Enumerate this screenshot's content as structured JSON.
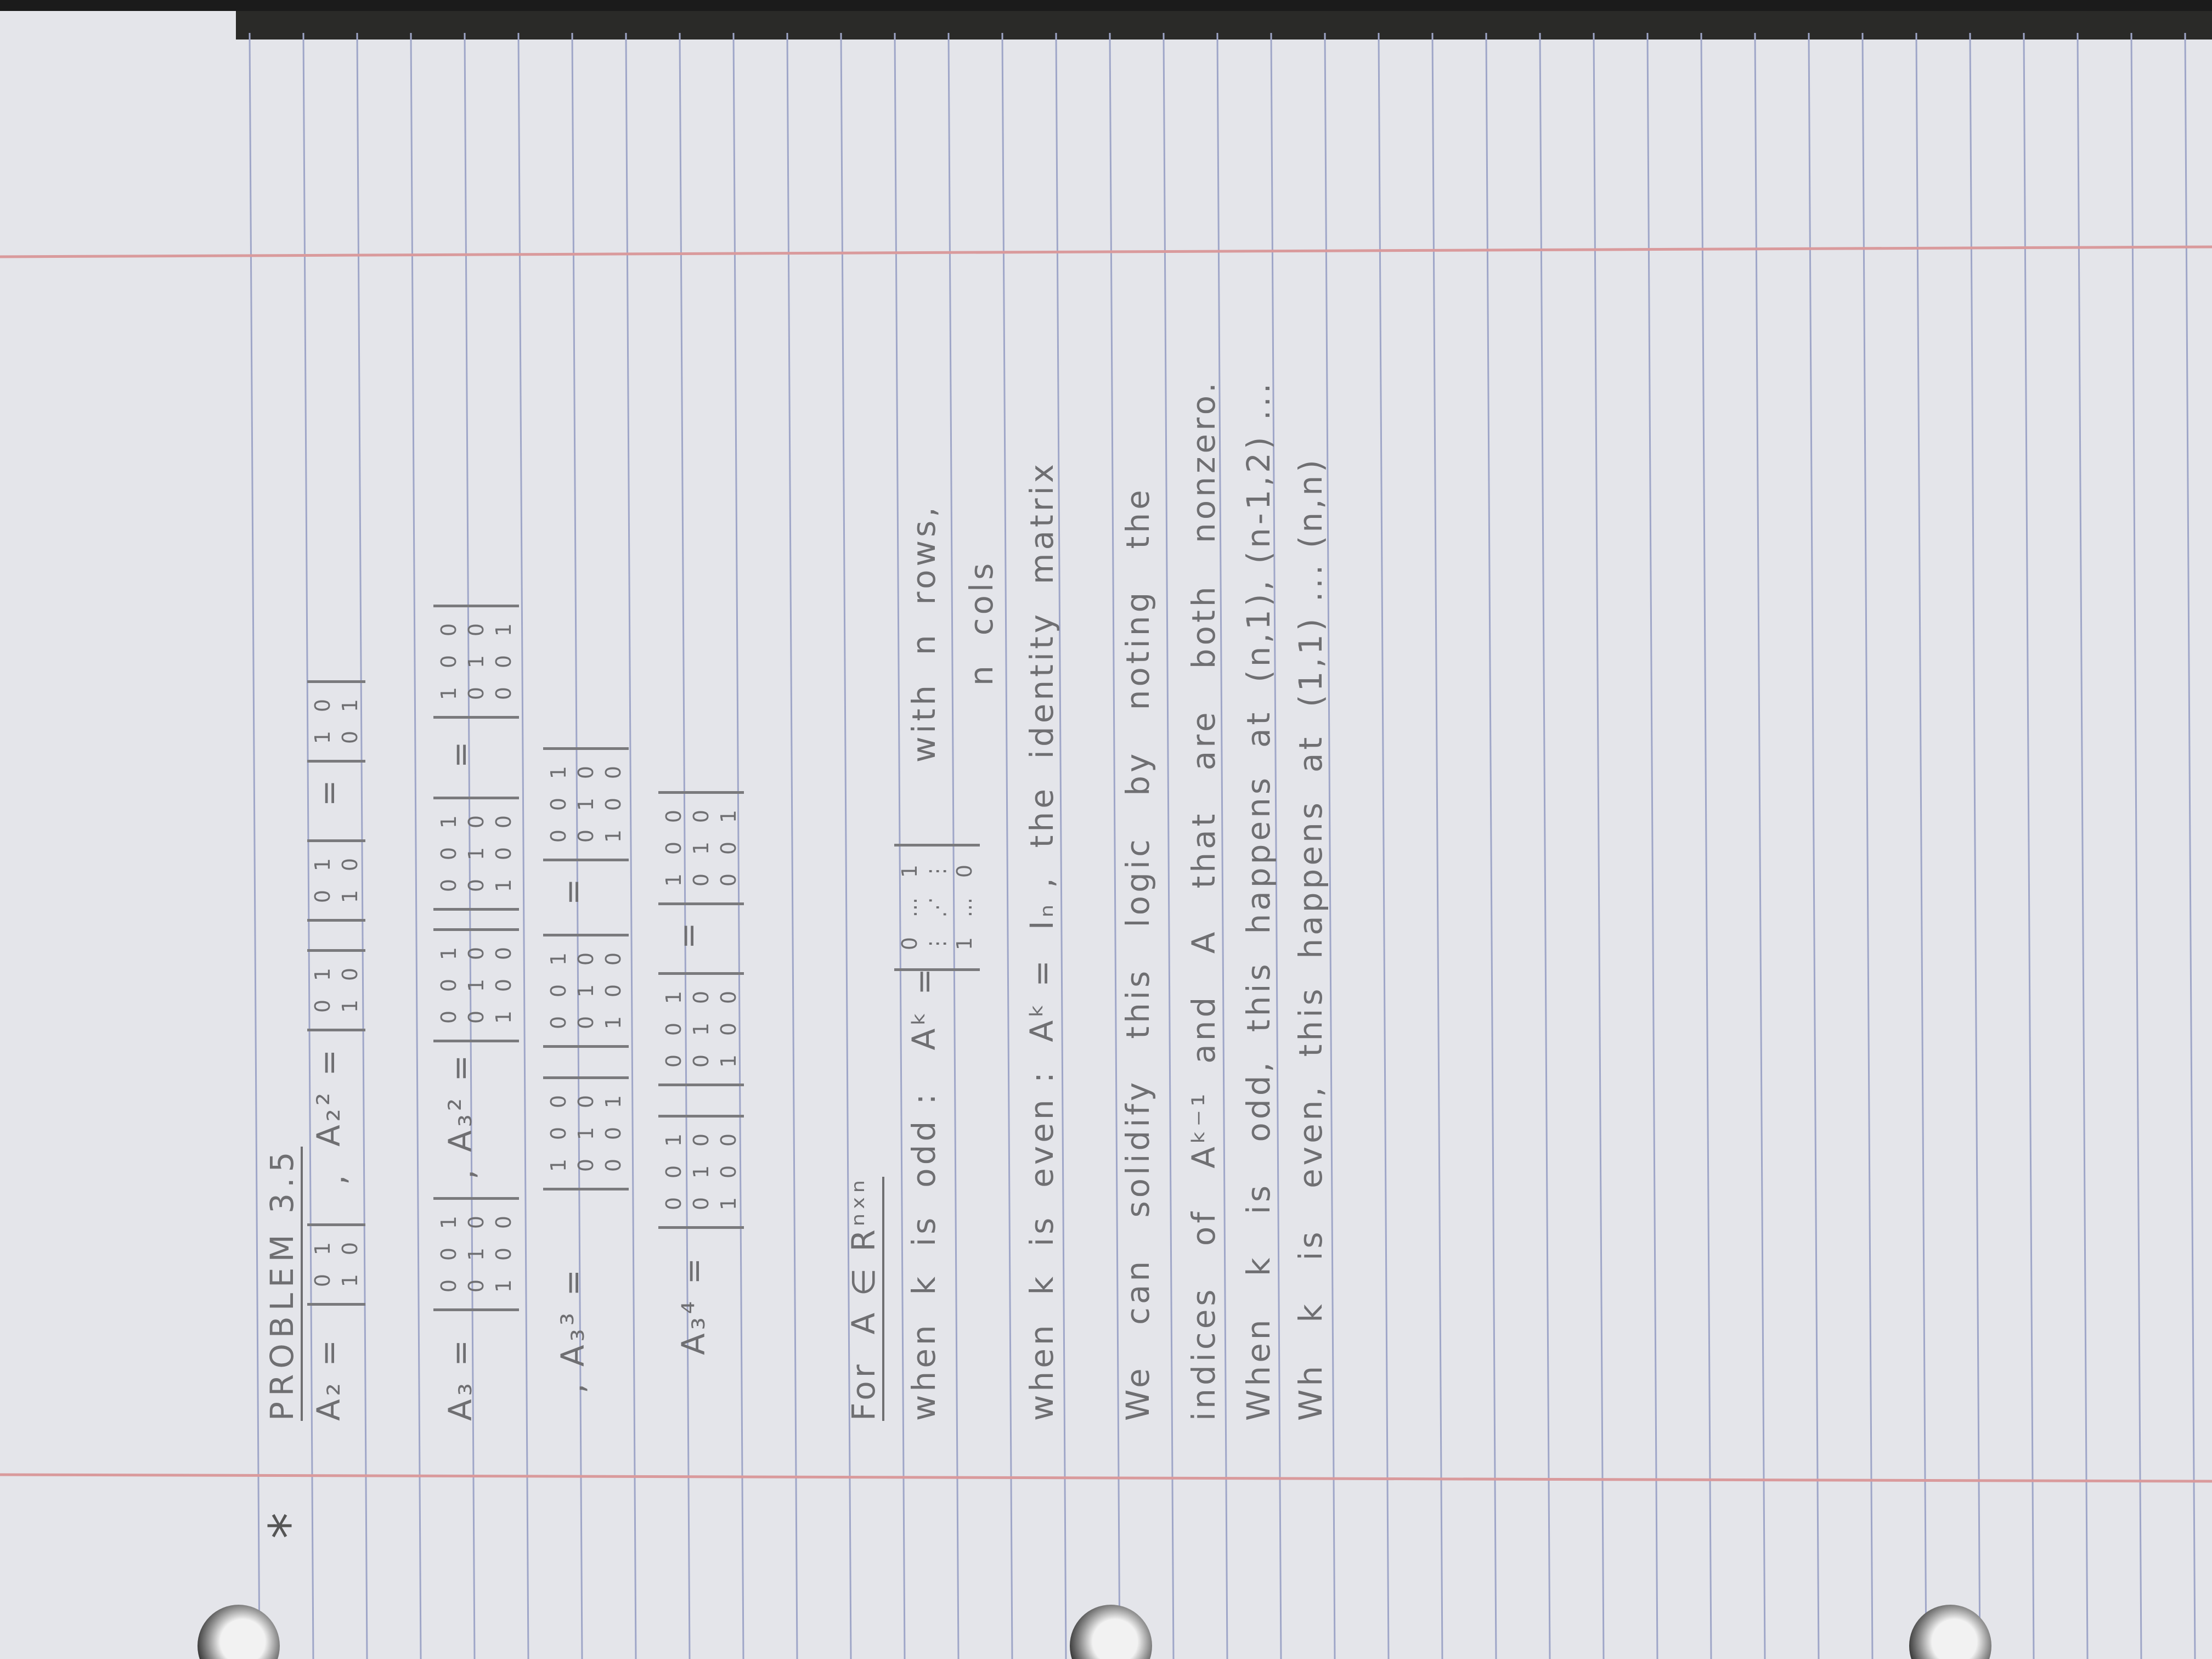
{
  "star": "*",
  "title": "PROBLEM 3.5",
  "eq1": {
    "lhs": "A₂ =",
    "m1": [
      "0",
      "1",
      "1",
      "0"
    ],
    "sep": ",",
    "lhs2": "A₂² =",
    "m2": [
      "0",
      "1",
      "1",
      "0"
    ],
    "m3": [
      "0",
      "1",
      "1",
      "0"
    ],
    "eq": "=",
    "m4": [
      "1",
      "0",
      "0",
      "1"
    ]
  },
  "eq2": {
    "lhs": "A₃ =",
    "m1": [
      "0",
      "0",
      "1",
      "0",
      "1",
      "0",
      "1",
      "0",
      "0"
    ],
    "sep": ",",
    "lhs2": "A₃² =",
    "m2": [
      "0",
      "0",
      "1",
      "0",
      "1",
      "0",
      "1",
      "0",
      "0"
    ],
    "m3": [
      "0",
      "0",
      "1",
      "0",
      "1",
      "0",
      "1",
      "0",
      "0"
    ],
    "eq": "=",
    "m4": [
      "1",
      "0",
      "0",
      "0",
      "1",
      "0",
      "0",
      "0",
      "1"
    ]
  },
  "eq3": {
    "lhs": ", A₃³ =",
    "m1": [
      "1",
      "0",
      "0",
      "0",
      "1",
      "0",
      "0",
      "0",
      "1"
    ],
    "m2": [
      "0",
      "0",
      "1",
      "0",
      "1",
      "0",
      "1",
      "0",
      "0"
    ],
    "eq": "=",
    "m3": [
      "0",
      "0",
      "1",
      "0",
      "1",
      "0",
      "1",
      "0",
      "0"
    ]
  },
  "eq4": {
    "lhs": "A₃⁴ =",
    "m1": [
      "0",
      "0",
      "1",
      "0",
      "1",
      "0",
      "1",
      "0",
      "0"
    ],
    "m2": [
      "0",
      "0",
      "1",
      "0",
      "1",
      "0",
      "1",
      "0",
      "0"
    ],
    "eq": "=",
    "m3": [
      "1",
      "0",
      "0",
      "0",
      "1",
      "0",
      "0",
      "0",
      "1"
    ]
  },
  "for_line": "For  A ∈ Rⁿˣⁿ",
  "odd_line": "when  k  is  odd :   Aᵏ =",
  "odd_matrix": [
    "0",
    "...",
    "1",
    "⋮",
    "⋰",
    "⋮",
    "1",
    "...",
    "0"
  ],
  "odd_note1": "with  n  rows,",
  "odd_note2": "n  cols",
  "even_line": "when  k  is  even :  Aᵏ =  Iₙ ,  the  identity  matrix",
  "para": [
    "We   can   solidify   this   logic   by   noting   the",
    "indices   of   Aᵏ⁻¹  and   A   that   are   both   nonzero.",
    "When   k   is   odd,  this  happens  at  (n,1), (n-1,2) ...",
    "Wh   k   is   even,  this  happens  at  (1,1) ... (n,n)"
  ]
}
